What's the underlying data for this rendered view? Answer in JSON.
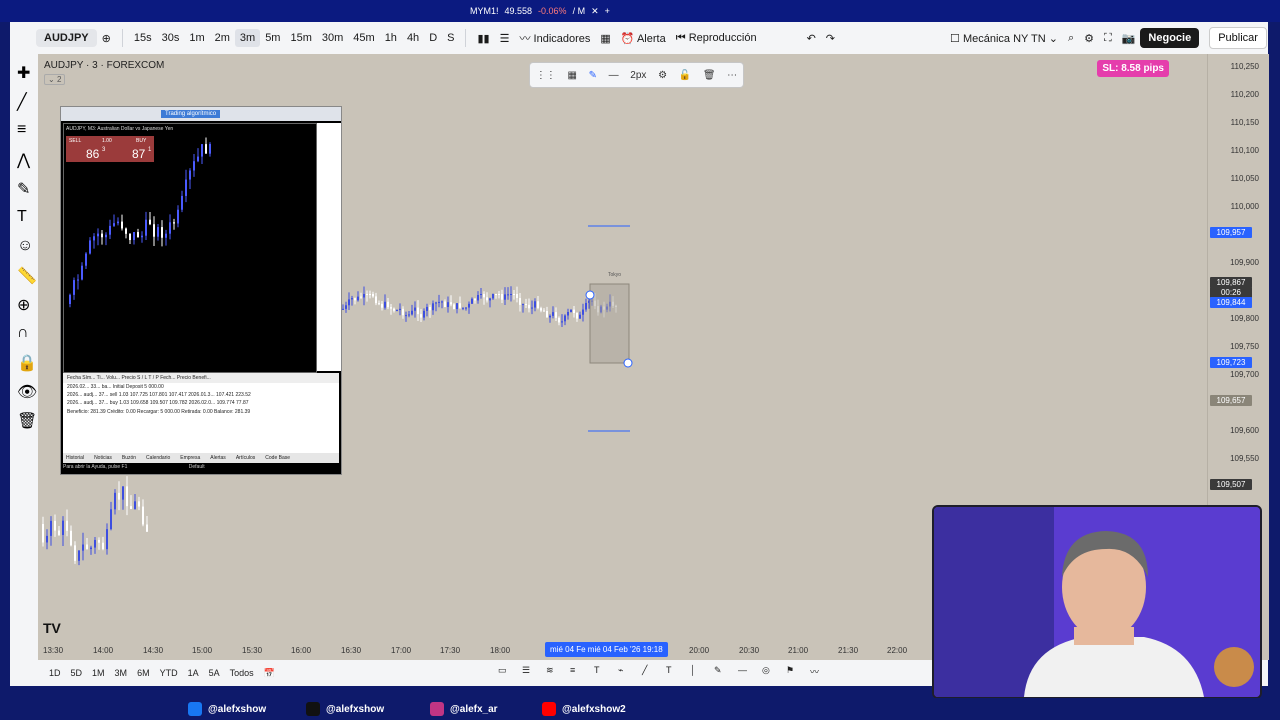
{
  "tab": {
    "symbol": "MYM1!",
    "price": "49.558",
    "change": "-0.06%",
    "suffix": "/ M"
  },
  "toolbar": {
    "symbol": "AUDJPY",
    "intervals": [
      "15s",
      "30s",
      "1m",
      "2m",
      "3m",
      "5m",
      "15m",
      "30m",
      "45m",
      "1h",
      "4h",
      "D",
      "S"
    ],
    "active_interval": "3m",
    "indicators": "Indicadores",
    "alert": "Alerta",
    "replay": "Reproducción",
    "layout": "Mecánica NY TN",
    "trade": "Negocie",
    "publish": "Publicar"
  },
  "chart": {
    "title": "AUDJPY · 3 · FOREXCOM",
    "collapse": "2",
    "stroke_label": "2px",
    "sl_badge": "SL: 8.58 pips",
    "prices": [
      "110,250",
      "110,200",
      "110,150",
      "110,100",
      "110,050",
      "110,000",
      "109,900",
      "109,800",
      "109,750",
      "109,700",
      "109,600",
      "109,550"
    ],
    "price_tags": {
      "blue_top": "109,957",
      "current": "109,867",
      "countdown": "00:26",
      "blue_mid": "109,844",
      "blue_low": "109,723",
      "gray": "109,657",
      "dark": "109,507"
    },
    "times": [
      "13:30",
      "14:00",
      "14:30",
      "15:00",
      "15:30",
      "16:00",
      "16:30",
      "17:00",
      "17:30",
      "18:00",
      "20:00",
      "20:30",
      "21:00",
      "21:30",
      "22:00"
    ],
    "time_selection": "mié 04 Fe  mié 04 Feb '26  19:18",
    "session_label": "Tokyo"
  },
  "mt": {
    "algo": "Trading algorítmico",
    "title": "AUDJPY, M3: Australian Dollar vs Japanese Yen",
    "sell": "SELL",
    "buy": "BUY",
    "lot": "1.00",
    "sell_price": "86",
    "sell_sup": "3",
    "buy_price": "87",
    "buy_sup": "1",
    "footer": "Para abrir la Ayuda, pulse F1",
    "footer_right": "Default",
    "terminal_header": "Fecha   Sím...  Ti...  Volu...  Precio   S / L   T / P   Fech...   Precio   Benefi...",
    "rows": [
      "2026.02...  33...  ba...  Initial Deposit                                  5 000.00",
      "2026...  audj...  37...  sell  1.03  107.725  107.801  107.417  2026.01.3...  107.421  223.52",
      "2026...  audj...  37...  buy  1.03  109.658  109.507  109.782  2026.02.0...  109.774  77.87"
    ],
    "balance": "Beneficio: 281.39  Crédito: 0.00  Recargar: 5 000.00  Retirada: 0.00  Balance: 281.39",
    "tabs": [
      "Historial",
      "Noticias",
      "Buzón",
      "Calendario",
      "Empresa",
      "Alertas",
      "Artículos",
      "Code Base"
    ]
  },
  "bottom": {
    "ranges": [
      "1D",
      "5D",
      "1M",
      "3M",
      "6M",
      "YTD",
      "1A",
      "5A",
      "Todos"
    ]
  },
  "footer": {
    "handles": [
      "@alefxshow",
      "@alefxshow",
      "@alefx_ar",
      "@alefxshow2"
    ]
  }
}
